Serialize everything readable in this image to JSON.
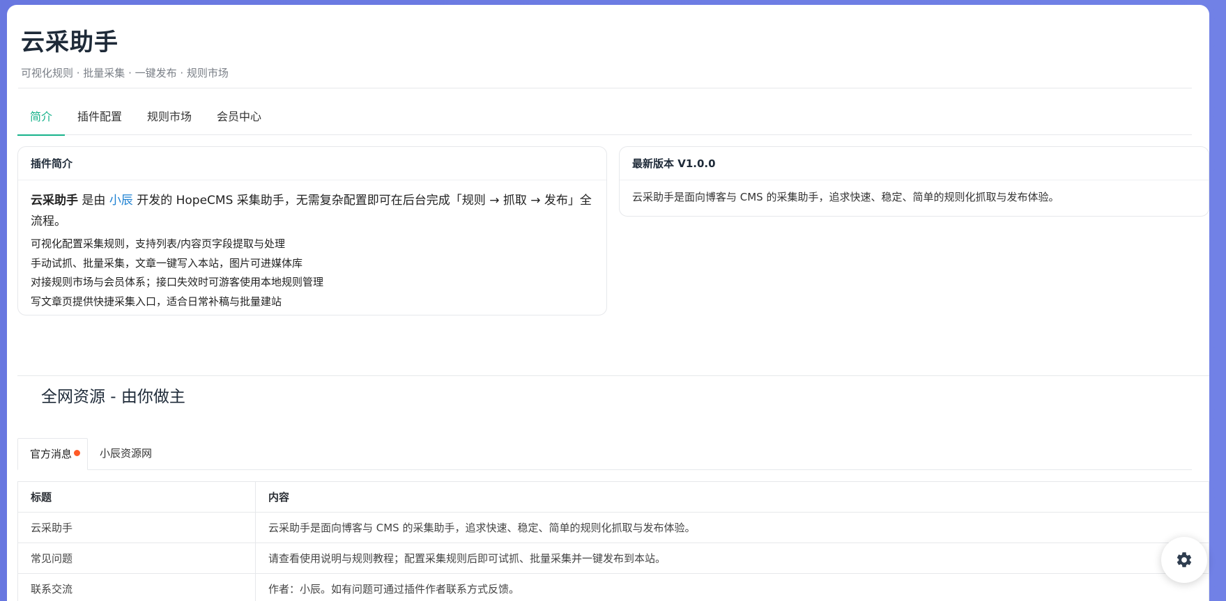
{
  "header": {
    "title": "云采助手",
    "subtitle": "可视化规则 · 批量采集 · 一键发布 · 规则市场"
  },
  "tabs": [
    {
      "label": "简介",
      "active": true
    },
    {
      "label": "插件配置",
      "active": false
    },
    {
      "label": "规则市场",
      "active": false
    },
    {
      "label": "会员中心",
      "active": false
    }
  ],
  "intro_card": {
    "heading": "插件简介",
    "lead_name": "云采助手",
    "lead_mid": " 是由 ",
    "lead_author": "小辰",
    "lead_rest": " 开发的 HopeCMS 采集助手，无需复杂配置即可在后台完成「规则 → 抓取 → 发布」全流程。",
    "items": [
      "可视化配置采集规则，支持列表/内容页字段提取与处理",
      "手动试抓、批量采集，文章一键写入本站，图片可进媒体库",
      "对接规则市场与会员体系；接口失效时可游客使用本地规则管理",
      "写文章页提供快捷采集入口，适合日常补稿与批量建站"
    ]
  },
  "version_card": {
    "heading": "最新版本 V1.0.0",
    "body": "云采助手是面向博客与 CMS 的采集助手，追求快速、稳定、简单的规则化抓取与发布体验。"
  },
  "section": {
    "title": "全网资源 - 由你做主"
  },
  "subtabs": [
    {
      "label": "官方消息",
      "active": true,
      "has_dot": true
    },
    {
      "label": "小辰资源网",
      "active": false,
      "has_dot": false
    }
  ],
  "table": {
    "headers": [
      "标题",
      "内容"
    ],
    "rows": [
      [
        "云采助手",
        "云采助手是面向博客与 CMS 的采集助手，追求快速、稳定、简单的规则化抓取与发布体验。"
      ],
      [
        "常见问题",
        "请查看使用说明与规则教程；配置采集规则后即可试抓、批量采集并一键发布到本站。"
      ],
      [
        "联系交流",
        "作者：小辰。如有问题可通过插件作者联系方式反馈。"
      ]
    ]
  },
  "colors": {
    "accent": "#16b28a",
    "link": "#1a7fd1",
    "notice_dot": "#ff5a26",
    "background_gradient": "#6877e0"
  },
  "fab": {
    "icon": "gear-icon"
  }
}
